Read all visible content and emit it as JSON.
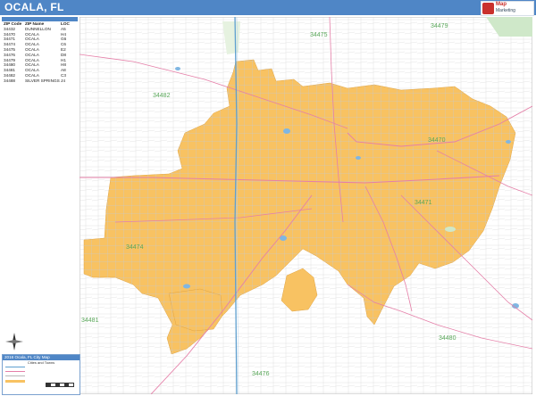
{
  "header": {
    "title": "OCALA, FL"
  },
  "brand": {
    "name": "Map",
    "tag": "Marketing"
  },
  "index": {
    "headers": [
      "ZIP Code",
      "ZIP Name",
      "LOC"
    ],
    "rows": [
      [
        "34432",
        "DUNNELLON",
        "A5"
      ],
      [
        "34470",
        "OCALA",
        "H4"
      ],
      [
        "34471",
        "OCALA",
        "G6"
      ],
      [
        "34474",
        "OCALA",
        "C6"
      ],
      [
        "34475",
        "OCALA",
        "E2"
      ],
      [
        "34476",
        "OCALA",
        "D8"
      ],
      [
        "34479",
        "OCALA",
        "H1"
      ],
      [
        "34480",
        "OCALA",
        "H8"
      ],
      [
        "34481",
        "OCALA",
        "A8"
      ],
      [
        "34482",
        "OCALA",
        "C3"
      ],
      [
        "34488",
        "SILVER SPRINGS",
        "J4"
      ]
    ]
  },
  "zip_labels": [
    {
      "code": "34475"
    },
    {
      "code": "34479"
    },
    {
      "code": "34482"
    },
    {
      "code": "34470"
    },
    {
      "code": "34471"
    },
    {
      "code": "34474"
    },
    {
      "code": "34481"
    },
    {
      "code": "34480"
    },
    {
      "code": "34476"
    }
  ],
  "legend": {
    "title": "2016 Ocala, FL City Map",
    "subtitle": "Cities and Towns"
  },
  "colors": {
    "city": "#f8c262",
    "road_major": "#e57fa8",
    "road_minor": "#b9b9b9",
    "zip_text": "#5aa75a",
    "water": "#7fb6e2",
    "park": "#cfe8c9",
    "header": "#4f86c6"
  }
}
